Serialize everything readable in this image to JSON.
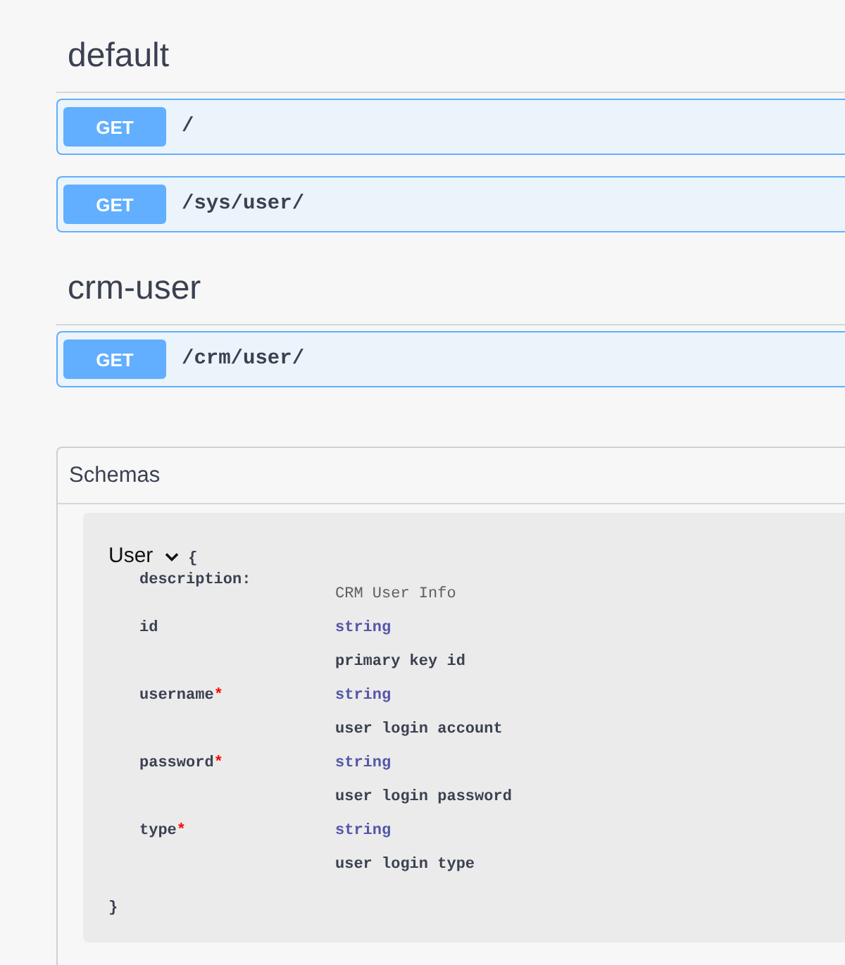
{
  "tags": [
    {
      "name": "default",
      "operations": [
        {
          "method": "GET",
          "path": "/"
        },
        {
          "method": "GET",
          "path": "/sys/user/"
        }
      ]
    },
    {
      "name": "crm-user",
      "operations": [
        {
          "method": "GET",
          "path": "/crm/user/"
        }
      ]
    }
  ],
  "schemas": {
    "title": "Schemas",
    "models": [
      {
        "name": "User",
        "expanded": true,
        "open_brace": "{",
        "close_brace": "}",
        "description_label": "description:",
        "description": "CRM User Info",
        "properties": [
          {
            "name": "id",
            "type": "string",
            "description": "primary key id"
          },
          {
            "name": "username",
            "required_mark": "*",
            "type": "string",
            "description": "user login account"
          },
          {
            "name": "password",
            "required_mark": "*",
            "type": "string",
            "description": "user login password"
          },
          {
            "name": "type",
            "required_mark": "*",
            "type": "string",
            "description": "user login type"
          }
        ]
      }
    ]
  }
}
